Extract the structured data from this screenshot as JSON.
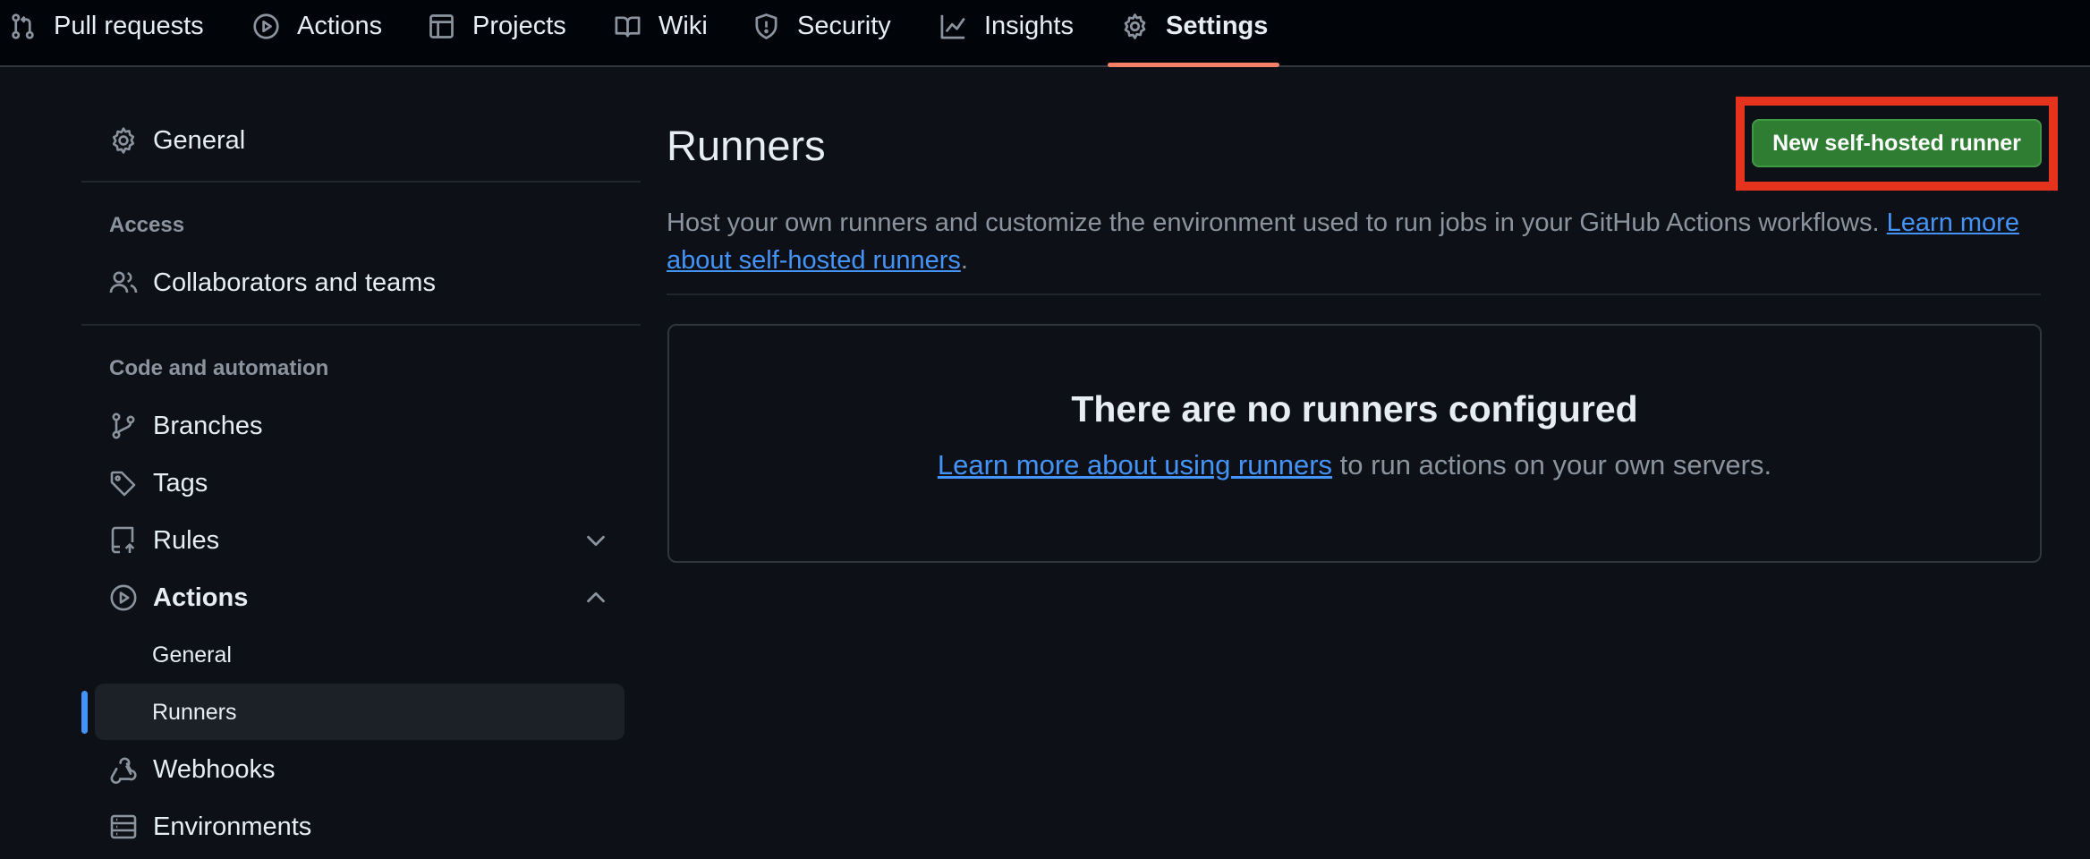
{
  "repo_nav": {
    "tabs": [
      {
        "label": "Pull requests",
        "icon": "git-pull-request-icon"
      },
      {
        "label": "Actions",
        "icon": "play-circle-icon"
      },
      {
        "label": "Projects",
        "icon": "table-icon"
      },
      {
        "label": "Wiki",
        "icon": "book-icon"
      },
      {
        "label": "Security",
        "icon": "shield-icon"
      },
      {
        "label": "Insights",
        "icon": "graph-icon"
      },
      {
        "label": "Settings",
        "icon": "gear-icon",
        "active": true
      }
    ],
    "active_underline_color": "#f78166"
  },
  "sidebar": {
    "general": "General",
    "access_heading": "Access",
    "collaborators": "Collaborators and teams",
    "code_heading": "Code and automation",
    "branches": "Branches",
    "tags": "Tags",
    "rules": "Rules",
    "actions": "Actions",
    "actions_sub": [
      "General",
      "Runners"
    ],
    "selected_sub": "Runners",
    "webhooks": "Webhooks",
    "environments": "Environments"
  },
  "main": {
    "title": "Runners",
    "new_button": "New self-hosted runner",
    "description": "Host your own runners and customize the environment used to run jobs in your GitHub Actions workflows.",
    "description_link_1": "Learn more",
    "description_link_2": "about self-hosted runners",
    "description_end": ".",
    "empty_title": "There are no runners configured",
    "empty_link": "Learn more about using runners",
    "empty_text": " to run actions on your own servers."
  },
  "colors": {
    "background": "#0d1117",
    "link": "#4493f8",
    "button": "#2f7d32",
    "highlight": "#e5331d"
  }
}
